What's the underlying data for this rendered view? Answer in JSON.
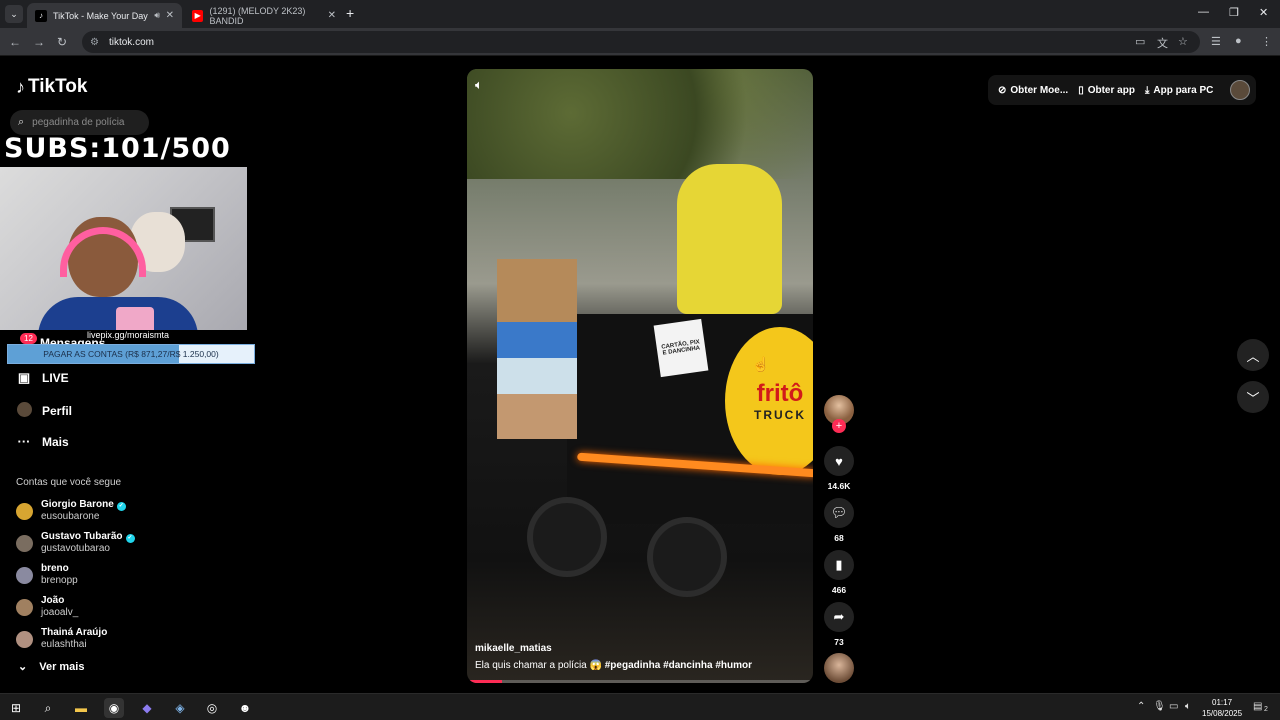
{
  "browser": {
    "tabs": [
      {
        "title": "TikTok - Make Your Day",
        "active": true
      },
      {
        "title": "(1291) (MELODY 2K23) BANDID",
        "active": false
      }
    ],
    "url": "tiktok.com"
  },
  "sidebar": {
    "logo": "TikTok",
    "search_placeholder": "pegadinha de polícia",
    "subs_overlay": "SUBS:101/500",
    "livepix": "livepix.gg/moraismta",
    "messages_badge": "12",
    "messages_label": "Mensagens",
    "goal": {
      "text": "PAGAR AS CONTAS (R$ 871,27/R$ 1.250,00)",
      "progress": 0.697
    },
    "nav": [
      {
        "label": "LIVE",
        "icon": "live-icon"
      },
      {
        "label": "Perfil",
        "icon": "profile-icon"
      },
      {
        "label": "Mais",
        "icon": "more-icon"
      }
    ],
    "following_title": "Contas que você segue",
    "following": [
      {
        "name": "Giorgio Barone",
        "handle": "eusoubarone",
        "verified": true,
        "color": "#d7a531"
      },
      {
        "name": "Gustavo Tubarão",
        "handle": "gustavotubarao",
        "verified": true,
        "color": "#7a6d60"
      },
      {
        "name": "breno",
        "handle": "brenopp",
        "verified": false,
        "color": "#8a8aa0"
      },
      {
        "name": "João",
        "handle": "joaoalv_",
        "verified": false,
        "color": "#a08060"
      },
      {
        "name": "Thainá Araújo",
        "handle": "eulashthai",
        "verified": false,
        "color": "#b09080"
      }
    ],
    "see_more": "Ver mais"
  },
  "topbar": {
    "coins": "Obter Moe...",
    "get_app": "Obter app",
    "pc_app": "App para PC"
  },
  "video": {
    "author": "mikaelle_matias",
    "caption_text": "Ela quis chamar a polícia 😱",
    "hashtags": "#pegadinha  #dancinha  #humor",
    "sign_text": "CARTÃO, PIX E DANCINHA",
    "logo_text": "fritô",
    "logo_sub": "TRUCK",
    "progress": 0.1
  },
  "actions": {
    "likes": "14.6K",
    "comments": "68",
    "saves": "466",
    "shares": "73"
  },
  "taskbar": {
    "time": "01:17",
    "date": "15/08/2025",
    "notifications": "2"
  }
}
